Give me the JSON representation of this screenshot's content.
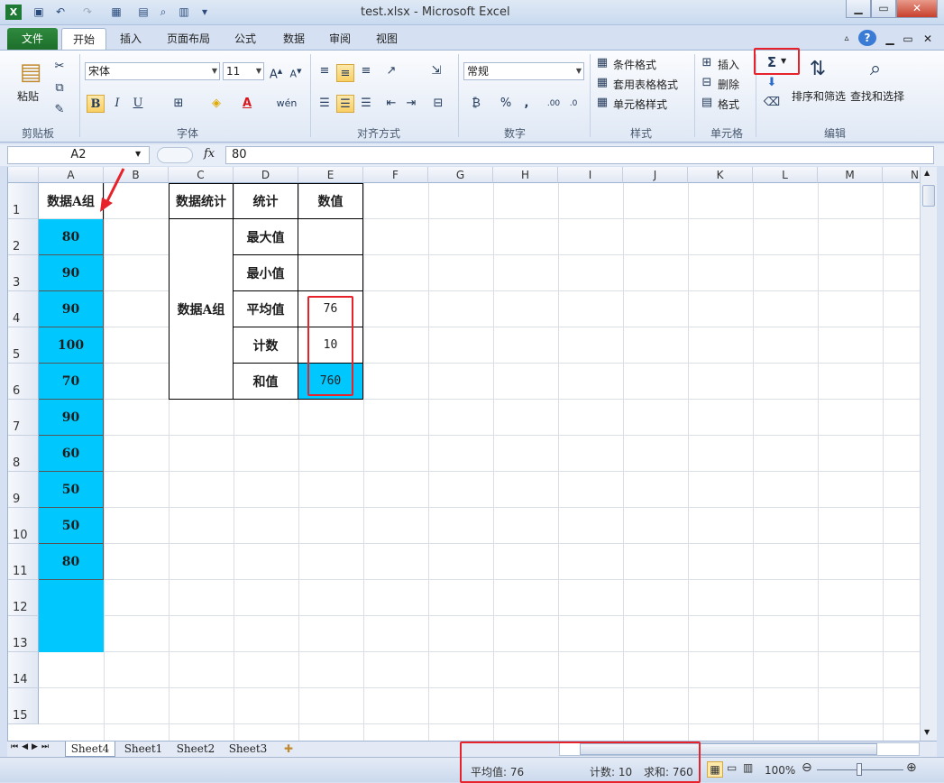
{
  "app": {
    "title": "test.xlsx - Microsoft Excel"
  },
  "tabs": [
    "文件",
    "开始",
    "插入",
    "页面布局",
    "公式",
    "数据",
    "审阅",
    "视图"
  ],
  "ribbon": {
    "clipboard": {
      "paste": "粘贴",
      "label": "剪贴板"
    },
    "font": {
      "name": "宋体",
      "size": "11",
      "label": "字体",
      "bold": "B",
      "italic": "I",
      "underline": "U"
    },
    "alignment": {
      "label": "对齐方式"
    },
    "number": {
      "format": "常规",
      "label": "数字",
      "percent": "%",
      "comma": ","
    },
    "styles": {
      "conditional": "条件格式",
      "table": "套用表格格式",
      "cell": "单元格样式",
      "label": "样式"
    },
    "cells": {
      "insert": "插入",
      "delete": "删除",
      "format": "格式",
      "label": "单元格"
    },
    "editing": {
      "sum": "Σ",
      "sort": "排序和筛选",
      "find": "查找和选择",
      "label": "编辑"
    }
  },
  "formula_bar": {
    "name_box": "A2",
    "fx": "fx",
    "value": "80"
  },
  "columns": [
    "A",
    "B",
    "C",
    "D",
    "E",
    "F",
    "G",
    "H",
    "I",
    "J",
    "K",
    "L",
    "M",
    "N"
  ],
  "rows": [
    "1",
    "2",
    "3",
    "4",
    "5",
    "6",
    "7",
    "8",
    "9",
    "10",
    "11",
    "12",
    "13",
    "14",
    "15"
  ],
  "cells": {
    "A1": "数据A组",
    "A_values": [
      "80",
      "90",
      "90",
      "100",
      "70",
      "90",
      "60",
      "50",
      "50",
      "80"
    ],
    "C1": "数据统计",
    "D1": "统计",
    "E1": "数值",
    "C_merged": "数据A组",
    "D_labels": [
      "最大值",
      "最小值",
      "平均值",
      "计数",
      "和值"
    ],
    "E_values": [
      "",
      "",
      "76",
      "10",
      "760"
    ]
  },
  "sheets": [
    "Sheet4",
    "Sheet1",
    "Sheet2",
    "Sheet3"
  ],
  "status": {
    "average": "平均值: 76",
    "count": "计数: 10",
    "sum": "求和: 760",
    "zoom": "100%"
  },
  "colors": {
    "highlight_fill": "#00c8ff",
    "annotation": "#e8222a"
  }
}
